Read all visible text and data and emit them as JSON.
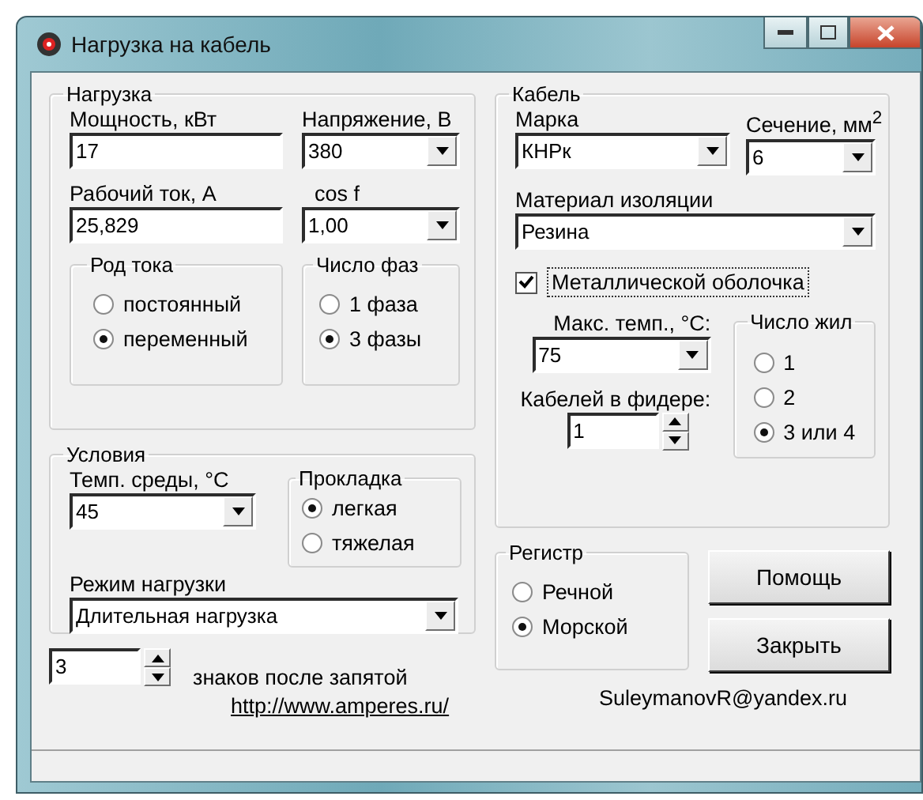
{
  "window": {
    "title": "Нагрузка на кабель"
  },
  "load": {
    "title": "Нагрузка",
    "power": {
      "label": "Мощность, кВт",
      "value": "17"
    },
    "voltage": {
      "label": "Напряжение, В",
      "value": "380"
    },
    "current": {
      "label": "Рабочий ток, А",
      "value": "25,829"
    },
    "cos": {
      "label": "cos f",
      "value": "1,00"
    },
    "current_type": {
      "title": "Род тока",
      "options": [
        {
          "label": "постоянный",
          "selected": false
        },
        {
          "label": "переменный",
          "selected": true
        }
      ]
    },
    "phases": {
      "title": "Число фаз",
      "options": [
        {
          "label": "1 фаза",
          "selected": false
        },
        {
          "label": "3 фазы",
          "selected": true
        }
      ]
    }
  },
  "conditions": {
    "title": "Условия",
    "temp": {
      "label": "Темп. среды, °C",
      "value": "45"
    },
    "laying": {
      "title": "Прокладка",
      "options": [
        {
          "label": "легкая",
          "selected": true
        },
        {
          "label": "тяжелая",
          "selected": false
        }
      ]
    },
    "mode": {
      "label": "Режим нагрузки",
      "value": "Длительная нагрузка"
    }
  },
  "decimals": {
    "value": "3",
    "label": "знаков после запятой"
  },
  "link": "http://www.amperes.ru/",
  "cable": {
    "title": "Кабель",
    "brand": {
      "label": "Марка",
      "value": "КНРк"
    },
    "section": {
      "label": "Сечение, мм$^{2}$",
      "value": "6"
    },
    "insulation": {
      "label": "Материал изоляции",
      "value": "Резина"
    },
    "sheath": {
      "label": "Металлической оболочка",
      "checked": true
    },
    "max_temp": {
      "label": "Макс. темп., °C:",
      "value": "75"
    },
    "feeder": {
      "label": "Кабелей в фидере:",
      "value": "1"
    },
    "cores": {
      "title": "Число жил",
      "options": [
        {
          "label": "1",
          "selected": false
        },
        {
          "label": "2",
          "selected": false
        },
        {
          "label": "3 или 4",
          "selected": true
        }
      ]
    }
  },
  "register": {
    "title": "Регистр",
    "options": [
      {
        "label": "Речной",
        "selected": false
      },
      {
        "label": "Морской",
        "selected": true
      }
    ]
  },
  "buttons": [
    "Помощь",
    "Закрыть"
  ],
  "email": "SuleymanovR@yandex.ru"
}
